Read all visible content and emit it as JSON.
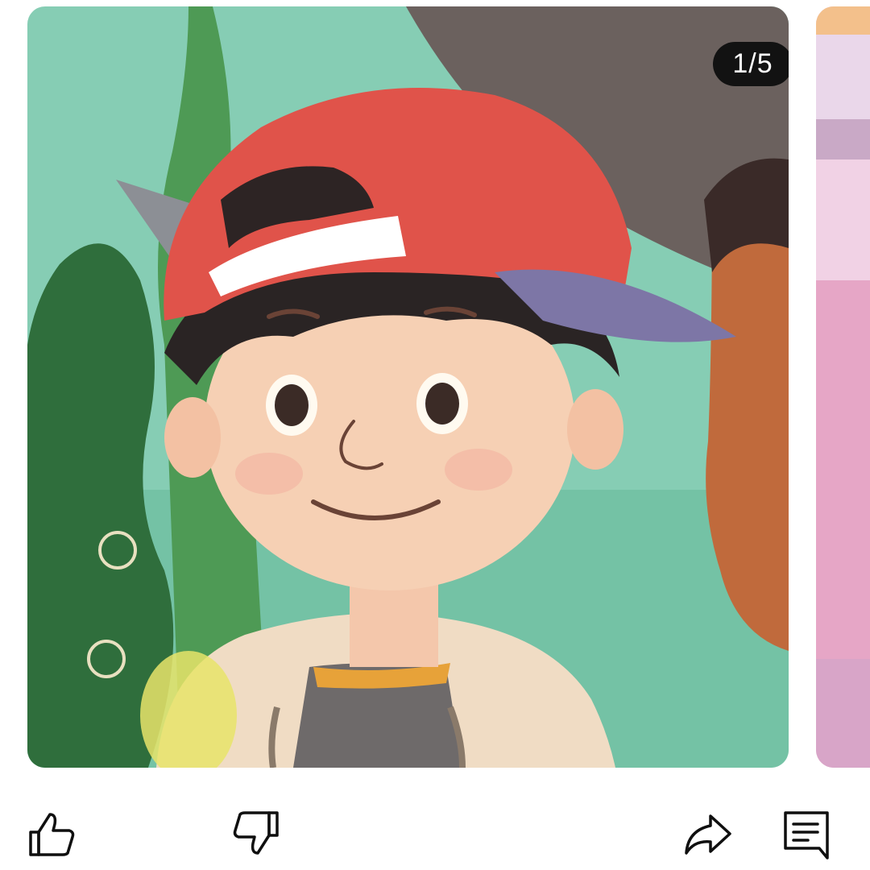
{
  "post": {
    "image_counter": "1/5",
    "current_image": 1,
    "total_images": 5
  },
  "actions": {
    "like_icon": "thumb-up-outline",
    "dislike_icon": "thumb-down-outline",
    "share_icon": "share-arrow",
    "comment_icon": "comment-bubble"
  },
  "colors": {
    "counter_background": "#121212",
    "counter_text": "#ffffff",
    "icon_stroke": "#0f0f0f"
  }
}
